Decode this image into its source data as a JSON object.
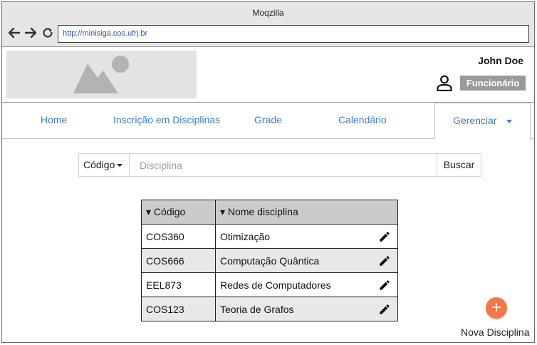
{
  "window": {
    "title": "Moqzilla"
  },
  "browser": {
    "url": "http://minisiga.cos.ufrj.br",
    "back_icon": "arrow-left-icon",
    "forward_icon": "arrow-right-icon",
    "reload_icon": "reload-icon"
  },
  "header": {
    "logo_icon": "image-placeholder-icon",
    "user_name": "John Doe",
    "user_icon": "user-icon",
    "role": "Funcionário"
  },
  "nav": {
    "tabs": [
      {
        "label": "Home"
      },
      {
        "label": "Inscrição em Disciplinas"
      },
      {
        "label": "Grade"
      },
      {
        "label": "Calendário"
      },
      {
        "label": "Gerenciar",
        "active": true
      }
    ]
  },
  "search": {
    "filter_label": "Código",
    "placeholder": "Disciplina",
    "value": "",
    "button_label": "Buscar"
  },
  "table": {
    "headers": [
      "▾ Código",
      "▾ Nome disciplina"
    ],
    "rows": [
      {
        "code": "COS360",
        "name": "Otimização"
      },
      {
        "code": "COS666",
        "name": "Computação Quântica"
      },
      {
        "code": "EEL873",
        "name": "Redes de Computadores"
      },
      {
        "code": "COS123",
        "name": "Teoria de Grafos"
      }
    ],
    "row_action_icon": "pencil-icon"
  },
  "add_button": {
    "symbol": "+",
    "label": "Nova Disciplina",
    "color": "#f2784b"
  },
  "colors": {
    "link": "#3d7dc4",
    "badge": "#9a9a9a",
    "header_row": "#cbcbcb",
    "zebra": "#e8e8e8"
  }
}
